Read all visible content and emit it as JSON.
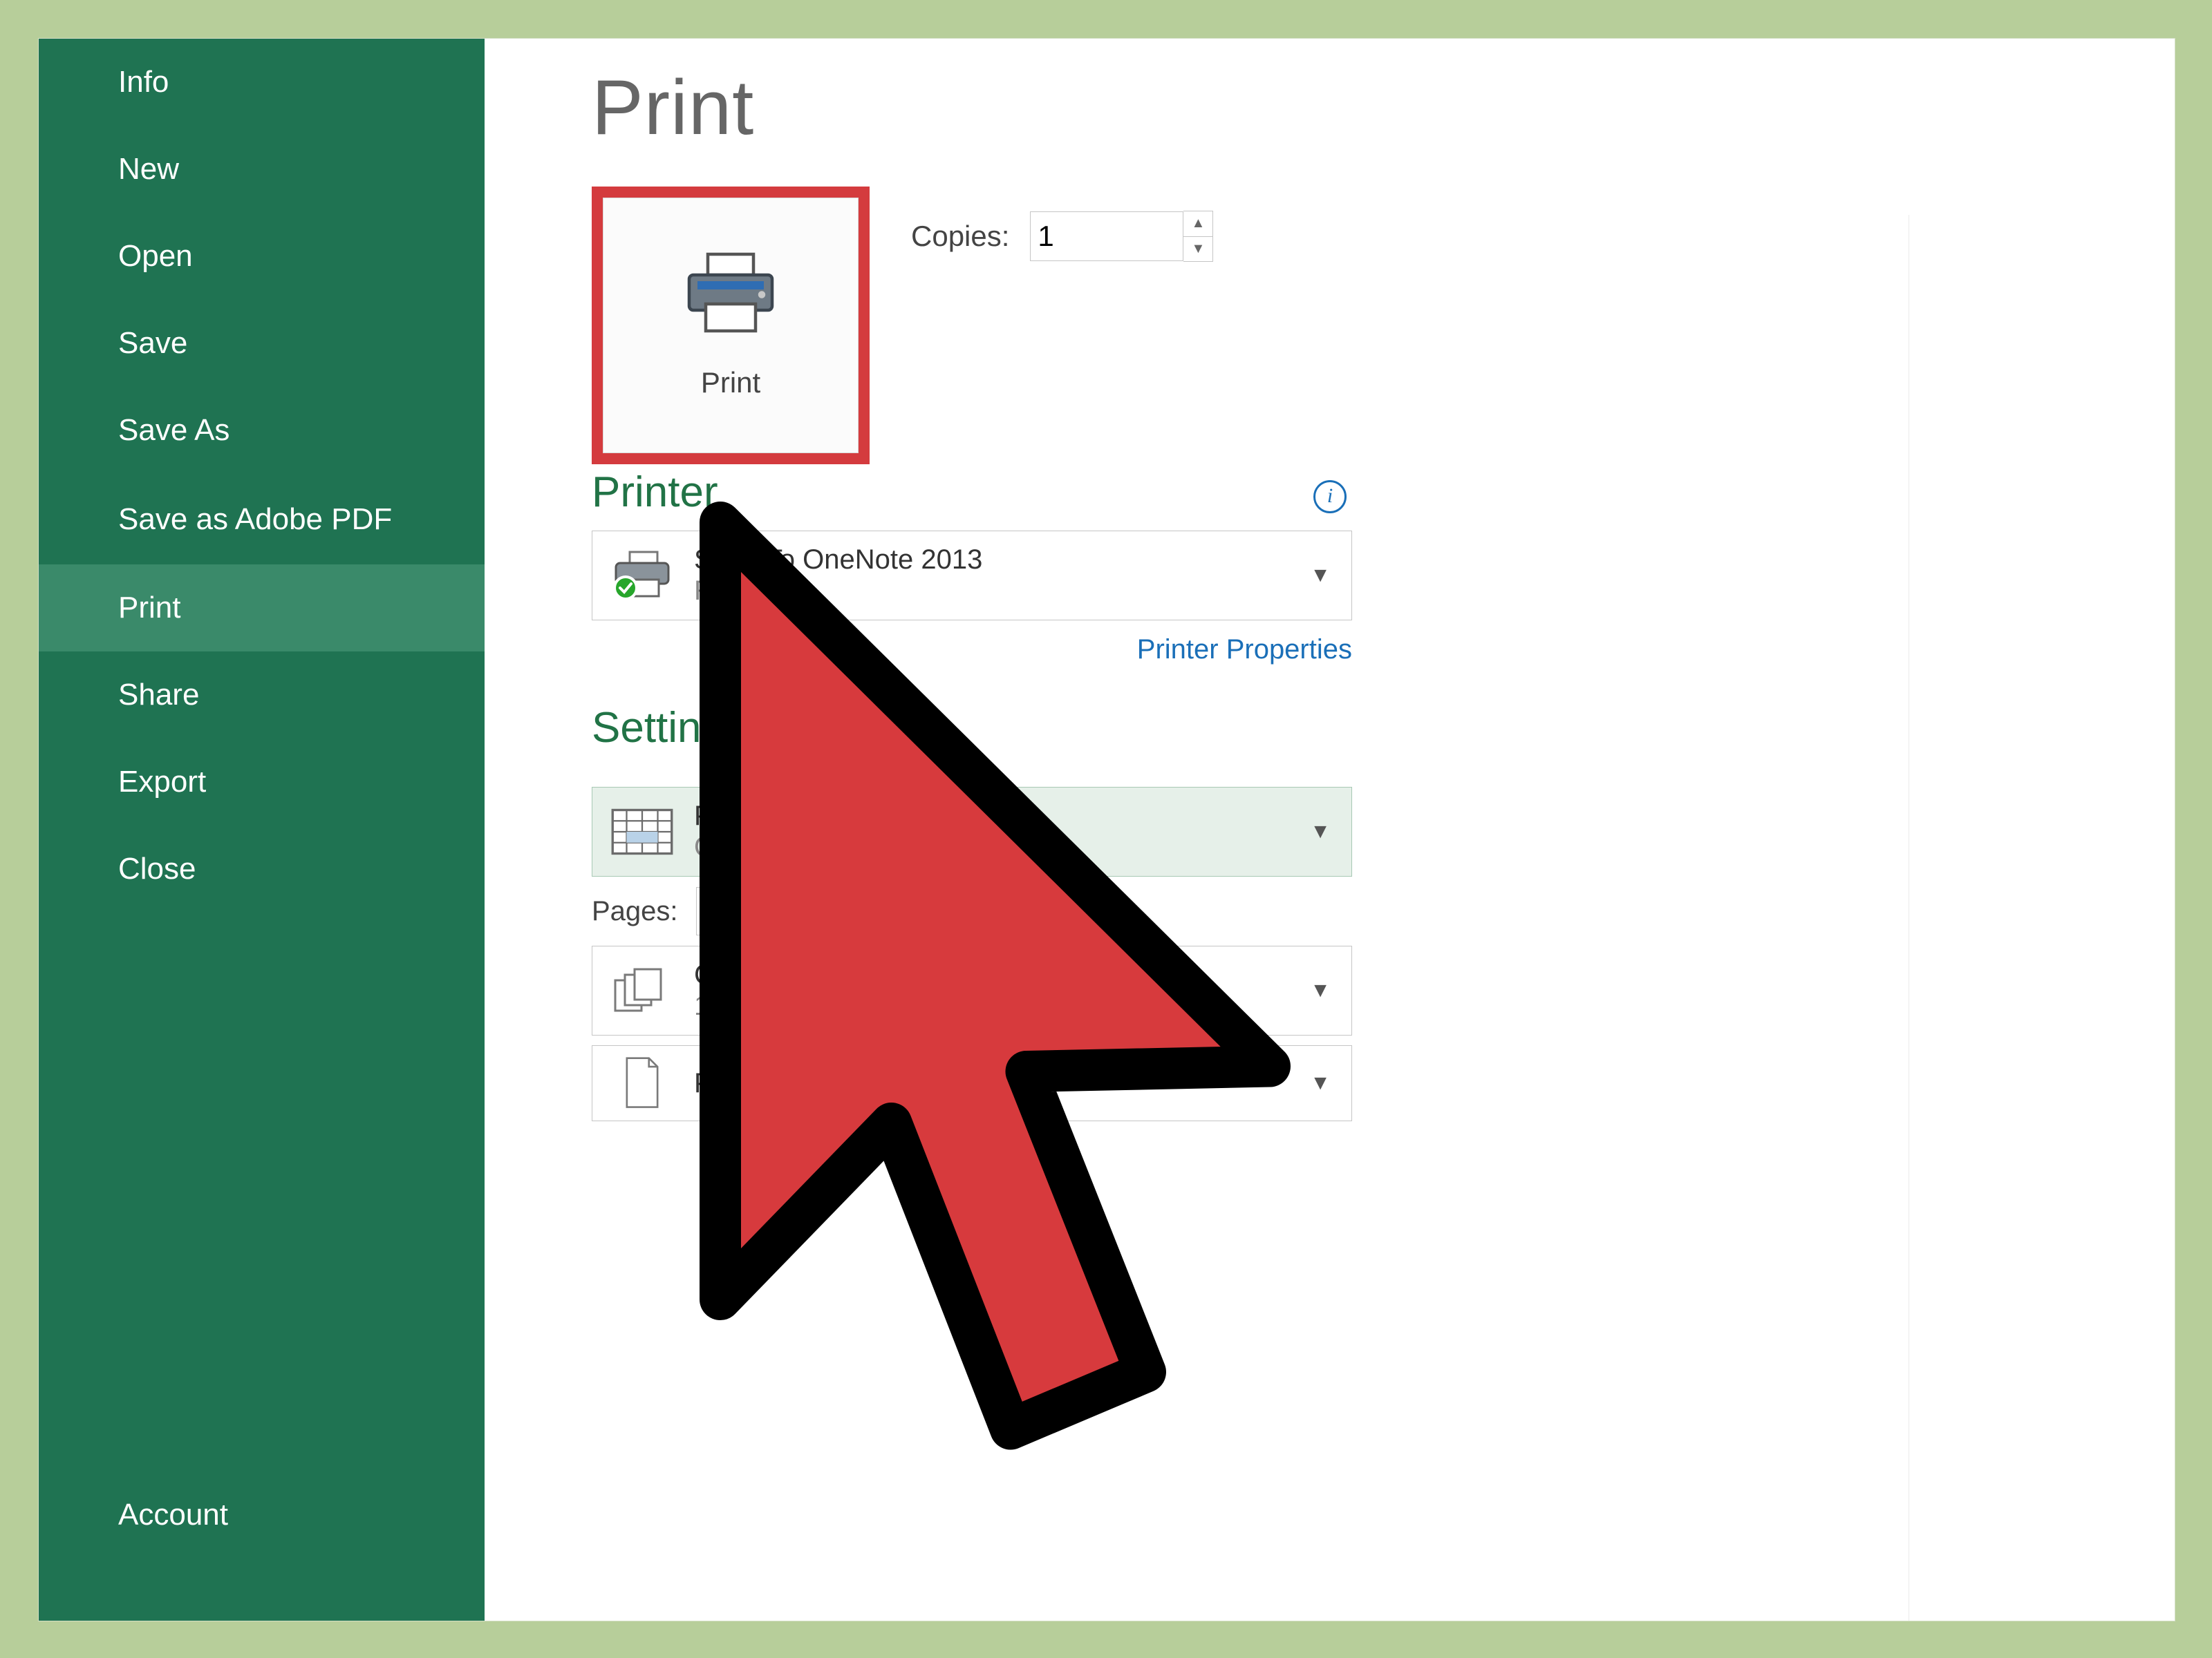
{
  "sidebar": {
    "items": [
      {
        "label": "Info"
      },
      {
        "label": "New"
      },
      {
        "label": "Open"
      },
      {
        "label": "Save"
      },
      {
        "label": "Save As"
      },
      {
        "label": "Save as Adobe PDF"
      },
      {
        "label": "Print",
        "selected": true
      },
      {
        "label": "Share"
      },
      {
        "label": "Export"
      },
      {
        "label": "Close"
      }
    ],
    "account": "Account"
  },
  "page": {
    "title": "Print"
  },
  "print_button": {
    "label": "Print"
  },
  "copies": {
    "label": "Copies:",
    "value": "1"
  },
  "printer": {
    "heading": "Printer",
    "name": "Send To OneNote 2013",
    "status": "Ready",
    "properties_link": "Printer Properties"
  },
  "settings": {
    "heading": "Settings",
    "what": {
      "line1": "Print Selection",
      "line2": "Only print the current selecti…"
    },
    "pages": {
      "label": "Pages:",
      "to": "to",
      "from": "",
      "to_val": ""
    },
    "collation": {
      "line1": "Collated",
      "line2": "1,2,3   1,2,3   1,2,3"
    },
    "orientation": {
      "line1": "Portrait Orientation"
    }
  }
}
